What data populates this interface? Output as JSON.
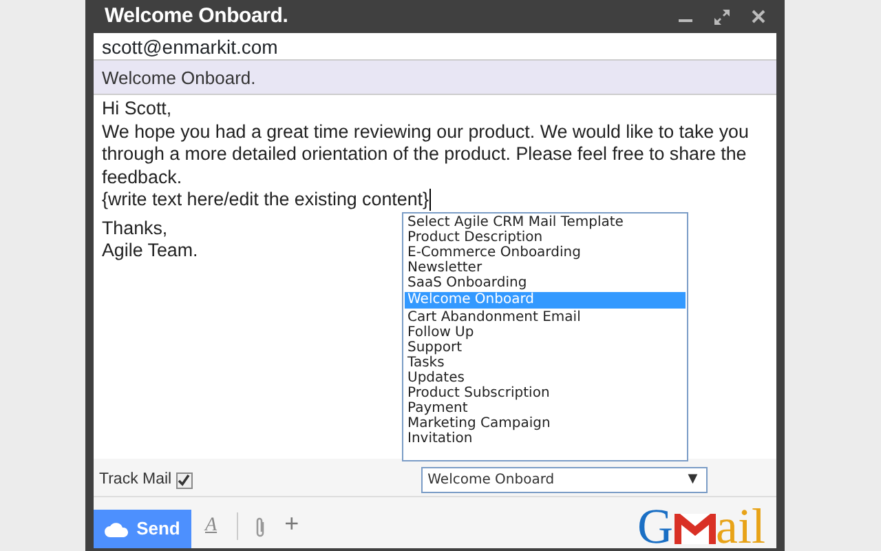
{
  "window": {
    "title": "Welcome Onboard."
  },
  "to": "scott@enmarkit.com",
  "subject": "Welcome Onboard.",
  "body": [
    "Hi Scott,",
    "We hope you had a great time reviewing our product. We would like to take you through a more detailed orientation of the product. Please feel free to share the feedback.",
    "{write text here/edit the existing content}",
    "Thanks,",
    "Agile Team."
  ],
  "template_list": [
    {
      "label": "Select Agile CRM Mail Template",
      "selected": false
    },
    {
      "label": "Product Description",
      "selected": false
    },
    {
      "label": "E-Commerce Onboarding",
      "selected": false
    },
    {
      "label": "Newsletter",
      "selected": false
    },
    {
      "label": "SaaS Onboarding",
      "selected": false
    },
    {
      "label": "Welcome Onboard",
      "selected": true
    },
    {
      "label": "Cart Abandonment Email",
      "selected": false
    },
    {
      "label": "Follow Up",
      "selected": false
    },
    {
      "label": "Support",
      "selected": false
    },
    {
      "label": "Tasks",
      "selected": false
    },
    {
      "label": "Updates",
      "selected": false
    },
    {
      "label": "Product Subscription",
      "selected": false
    },
    {
      "label": "Payment",
      "selected": false
    },
    {
      "label": "Marketing Campaign",
      "selected": false
    },
    {
      "label": "Invitation",
      "selected": false
    }
  ],
  "track_mail": {
    "label": "Track Mail",
    "checked": true
  },
  "template_select": {
    "value": "Welcome Onboard",
    "arrow": "▼"
  },
  "toolbar": {
    "send": "Send",
    "format": "A",
    "more": "+"
  },
  "logo": {
    "first": "G",
    "rest": "ail"
  }
}
